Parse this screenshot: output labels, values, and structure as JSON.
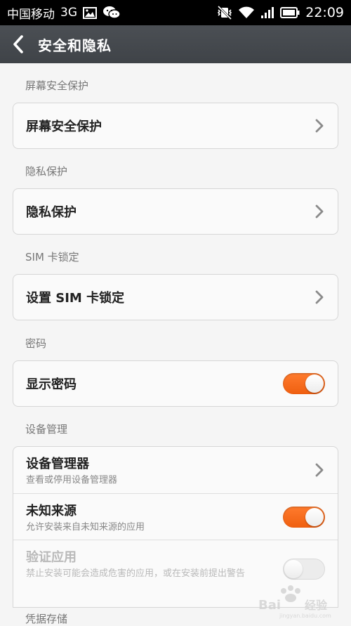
{
  "statusbar": {
    "carrier": "中国移动",
    "network": "3G",
    "time": "22:09"
  },
  "titlebar": {
    "title": "安全和隐私"
  },
  "sections": {
    "screen": {
      "label": "屏幕安全保护",
      "item": "屏幕安全保护"
    },
    "privacy": {
      "label": "隐私保护",
      "item": "隐私保护"
    },
    "sim": {
      "label": "SIM 卡锁定",
      "item": "设置 SIM 卡锁定"
    },
    "password": {
      "label": "密码",
      "item": "显示密码",
      "toggle_on": true
    },
    "device": {
      "label": "设备管理",
      "items": [
        {
          "title": "设备管理器",
          "subtitle": "查看或停用设备管理器"
        },
        {
          "title": "未知来源",
          "subtitle": "允许安装来自未知来源的应用",
          "toggle_on": true
        },
        {
          "title": "验证应用",
          "subtitle": "禁止安装可能会造成危害的应用，或在安装前提出警告",
          "toggle_on": false,
          "disabled": true
        }
      ]
    },
    "credentials": {
      "label": "凭据存储"
    }
  },
  "colors": {
    "accent": "#f26a1b",
    "titlebar": "#44484d",
    "background": "#f5f5f5"
  },
  "icons": {
    "back": "chevron-left-icon",
    "chevron": "chevron-right-icon",
    "image": "image-icon",
    "wechat": "wechat-icon",
    "mute": "vibrate-off-icon",
    "wifi": "wifi-icon",
    "signal": "signal-icon",
    "battery": "battery-icon"
  }
}
